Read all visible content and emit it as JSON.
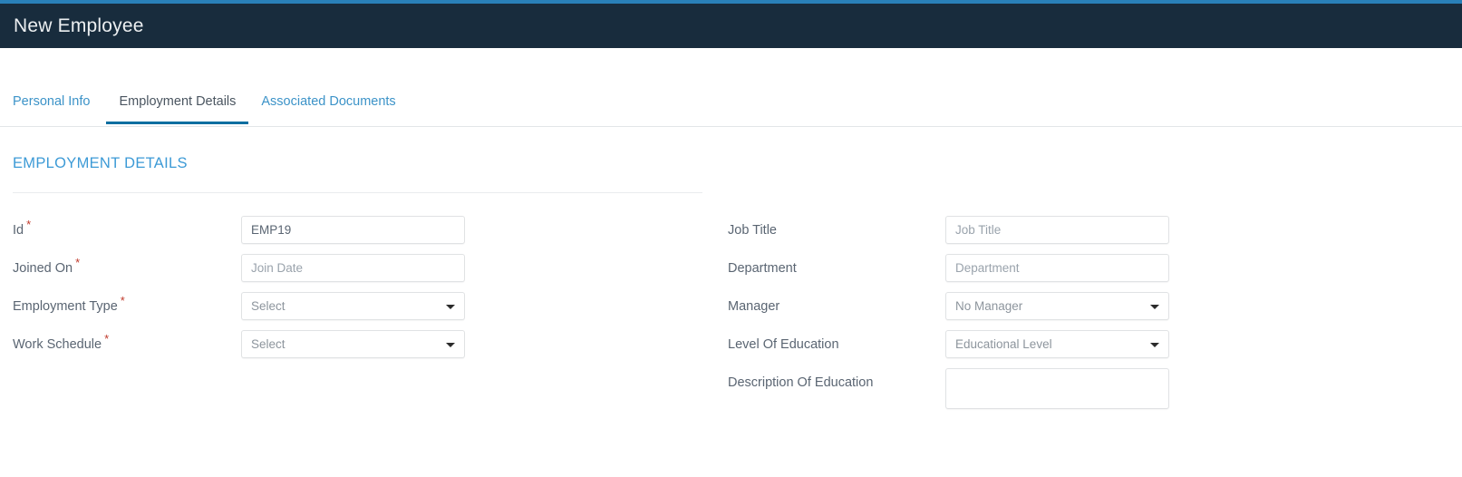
{
  "theme": {
    "accent_bar": "#2980b9",
    "header_bg": "#182c3d",
    "link_blue": "#3c93c8",
    "active_tab_underline": "#0a6ea0",
    "section_heading": "#3c9ad6",
    "required_marker": "#c0392b"
  },
  "header": {
    "title": "New Employee"
  },
  "tabs": [
    {
      "label": "Personal Info",
      "active": false
    },
    {
      "label": "Employment Details",
      "active": true
    },
    {
      "label": "Associated Documents",
      "active": false
    }
  ],
  "section": {
    "title": "EMPLOYMENT DETAILS"
  },
  "form": {
    "left": [
      {
        "label": "Id",
        "required": true,
        "type": "text",
        "value": "EMP19",
        "placeholder": ""
      },
      {
        "label": "Joined On",
        "required": true,
        "type": "text",
        "value": "",
        "placeholder": "Join Date"
      },
      {
        "label": "Employment Type",
        "required": true,
        "type": "select",
        "value": "Select",
        "placeholder": ""
      },
      {
        "label": "Work Schedule",
        "required": true,
        "type": "select",
        "value": "Select",
        "placeholder": ""
      }
    ],
    "right": [
      {
        "label": "Job Title",
        "required": false,
        "type": "text",
        "value": "",
        "placeholder": "Job Title"
      },
      {
        "label": "Department",
        "required": false,
        "type": "text",
        "value": "",
        "placeholder": "Department"
      },
      {
        "label": "Manager",
        "required": false,
        "type": "select",
        "value": "No Manager",
        "placeholder": ""
      },
      {
        "label": "Level Of Education",
        "required": false,
        "type": "select",
        "value": "Educational Level",
        "placeholder": ""
      },
      {
        "label": "Description Of Education",
        "required": false,
        "type": "textarea",
        "value": "",
        "placeholder": ""
      }
    ]
  },
  "required_symbol": "*"
}
